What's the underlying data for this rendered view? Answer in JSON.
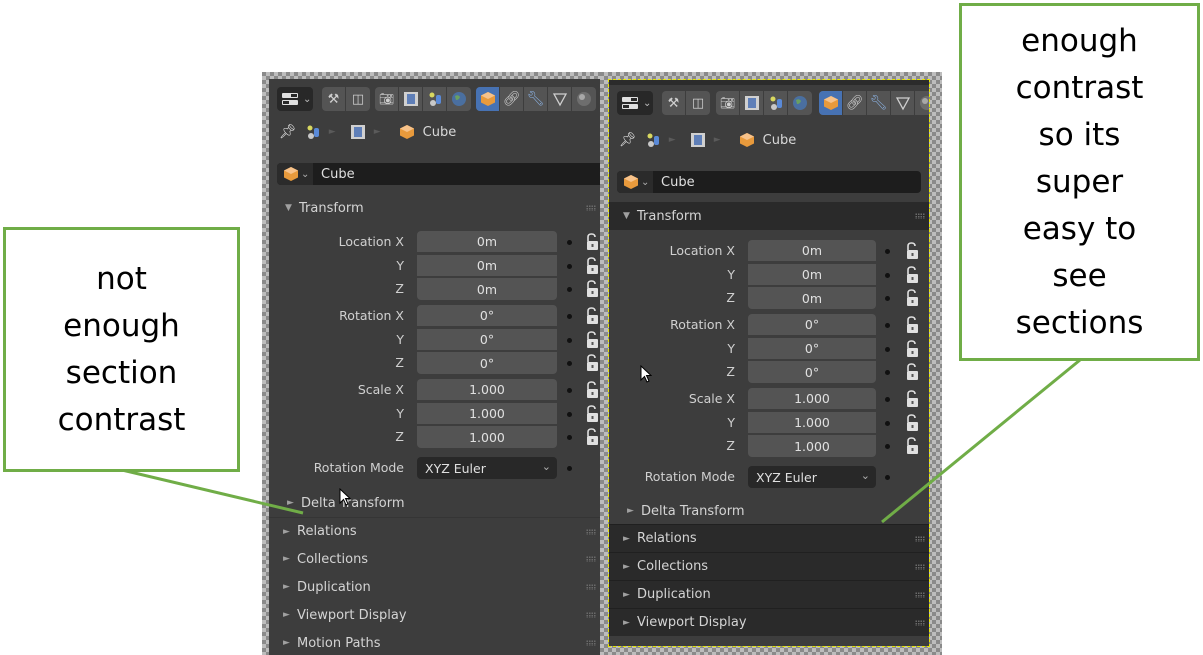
{
  "callouts": {
    "left": {
      "lines": [
        "not",
        "enough",
        "section",
        "contrast"
      ]
    },
    "right": {
      "lines": [
        "enough",
        "contrast",
        "so its",
        "super",
        "easy to",
        "see",
        "sections"
      ]
    },
    "border_color": "#70ad47"
  },
  "panels": {
    "left": {
      "variant": "low-contrast",
      "toolbar": {
        "editor_type_icon": "properties-editor-icon",
        "tabs_group1": [
          "tool-icon",
          "render-layout-icon"
        ],
        "tabs_group2": [
          "render-icon",
          "output-icon",
          "view-layer-icon",
          "world-icon"
        ],
        "tabs_group3": [
          "object-icon",
          "constraints-icon",
          "modifier-icon",
          "data-icon",
          "material-icon"
        ],
        "active_tab": "object-icon"
      },
      "breadcrumb": {
        "items": [
          "scene-icon",
          "view-layer-icon",
          "Cube"
        ],
        "pin_icon": "pin-icon"
      },
      "object_name": "Cube",
      "sections": {
        "transform": {
          "label": "Transform",
          "expanded": true
        },
        "delta_transform": {
          "label": "Delta Transform",
          "expanded": false
        },
        "collapsed": [
          "Relations",
          "Collections",
          "Duplication",
          "Viewport Display",
          "Motion Paths"
        ]
      },
      "properties": [
        {
          "label": "Location X",
          "value": "0m"
        },
        {
          "label": "Y",
          "value": "0m"
        },
        {
          "label": "Z",
          "value": "0m"
        },
        {
          "label": "Rotation X",
          "value": "0°"
        },
        {
          "label": "Y",
          "value": "0°"
        },
        {
          "label": "Z",
          "value": "0°"
        },
        {
          "label": "Scale X",
          "value": "1.000"
        },
        {
          "label": "Y",
          "value": "1.000"
        },
        {
          "label": "Z",
          "value": "1.000"
        }
      ],
      "rotation_mode": {
        "label": "Rotation Mode",
        "value": "XYZ Euler"
      }
    },
    "right": {
      "variant": "high-contrast",
      "object_name": "Cube",
      "breadcrumb_label": "Cube",
      "sections": {
        "transform": {
          "label": "Transform",
          "expanded": true
        },
        "delta_transform": {
          "label": "Delta Transform",
          "expanded": false
        },
        "collapsed": [
          "Relations",
          "Collections",
          "Duplication",
          "Viewport Display"
        ]
      },
      "properties": [
        {
          "label": "Location X",
          "value": "0m"
        },
        {
          "label": "Y",
          "value": "0m"
        },
        {
          "label": "Z",
          "value": "0m"
        },
        {
          "label": "Rotation X",
          "value": "0°"
        },
        {
          "label": "Y",
          "value": "0°"
        },
        {
          "label": "Z",
          "value": "0°"
        },
        {
          "label": "Scale X",
          "value": "1.000"
        },
        {
          "label": "Y",
          "value": "1.000"
        },
        {
          "label": "Z",
          "value": "1.000"
        }
      ],
      "rotation_mode": {
        "label": "Rotation Mode",
        "value": "XYZ Euler"
      }
    }
  }
}
